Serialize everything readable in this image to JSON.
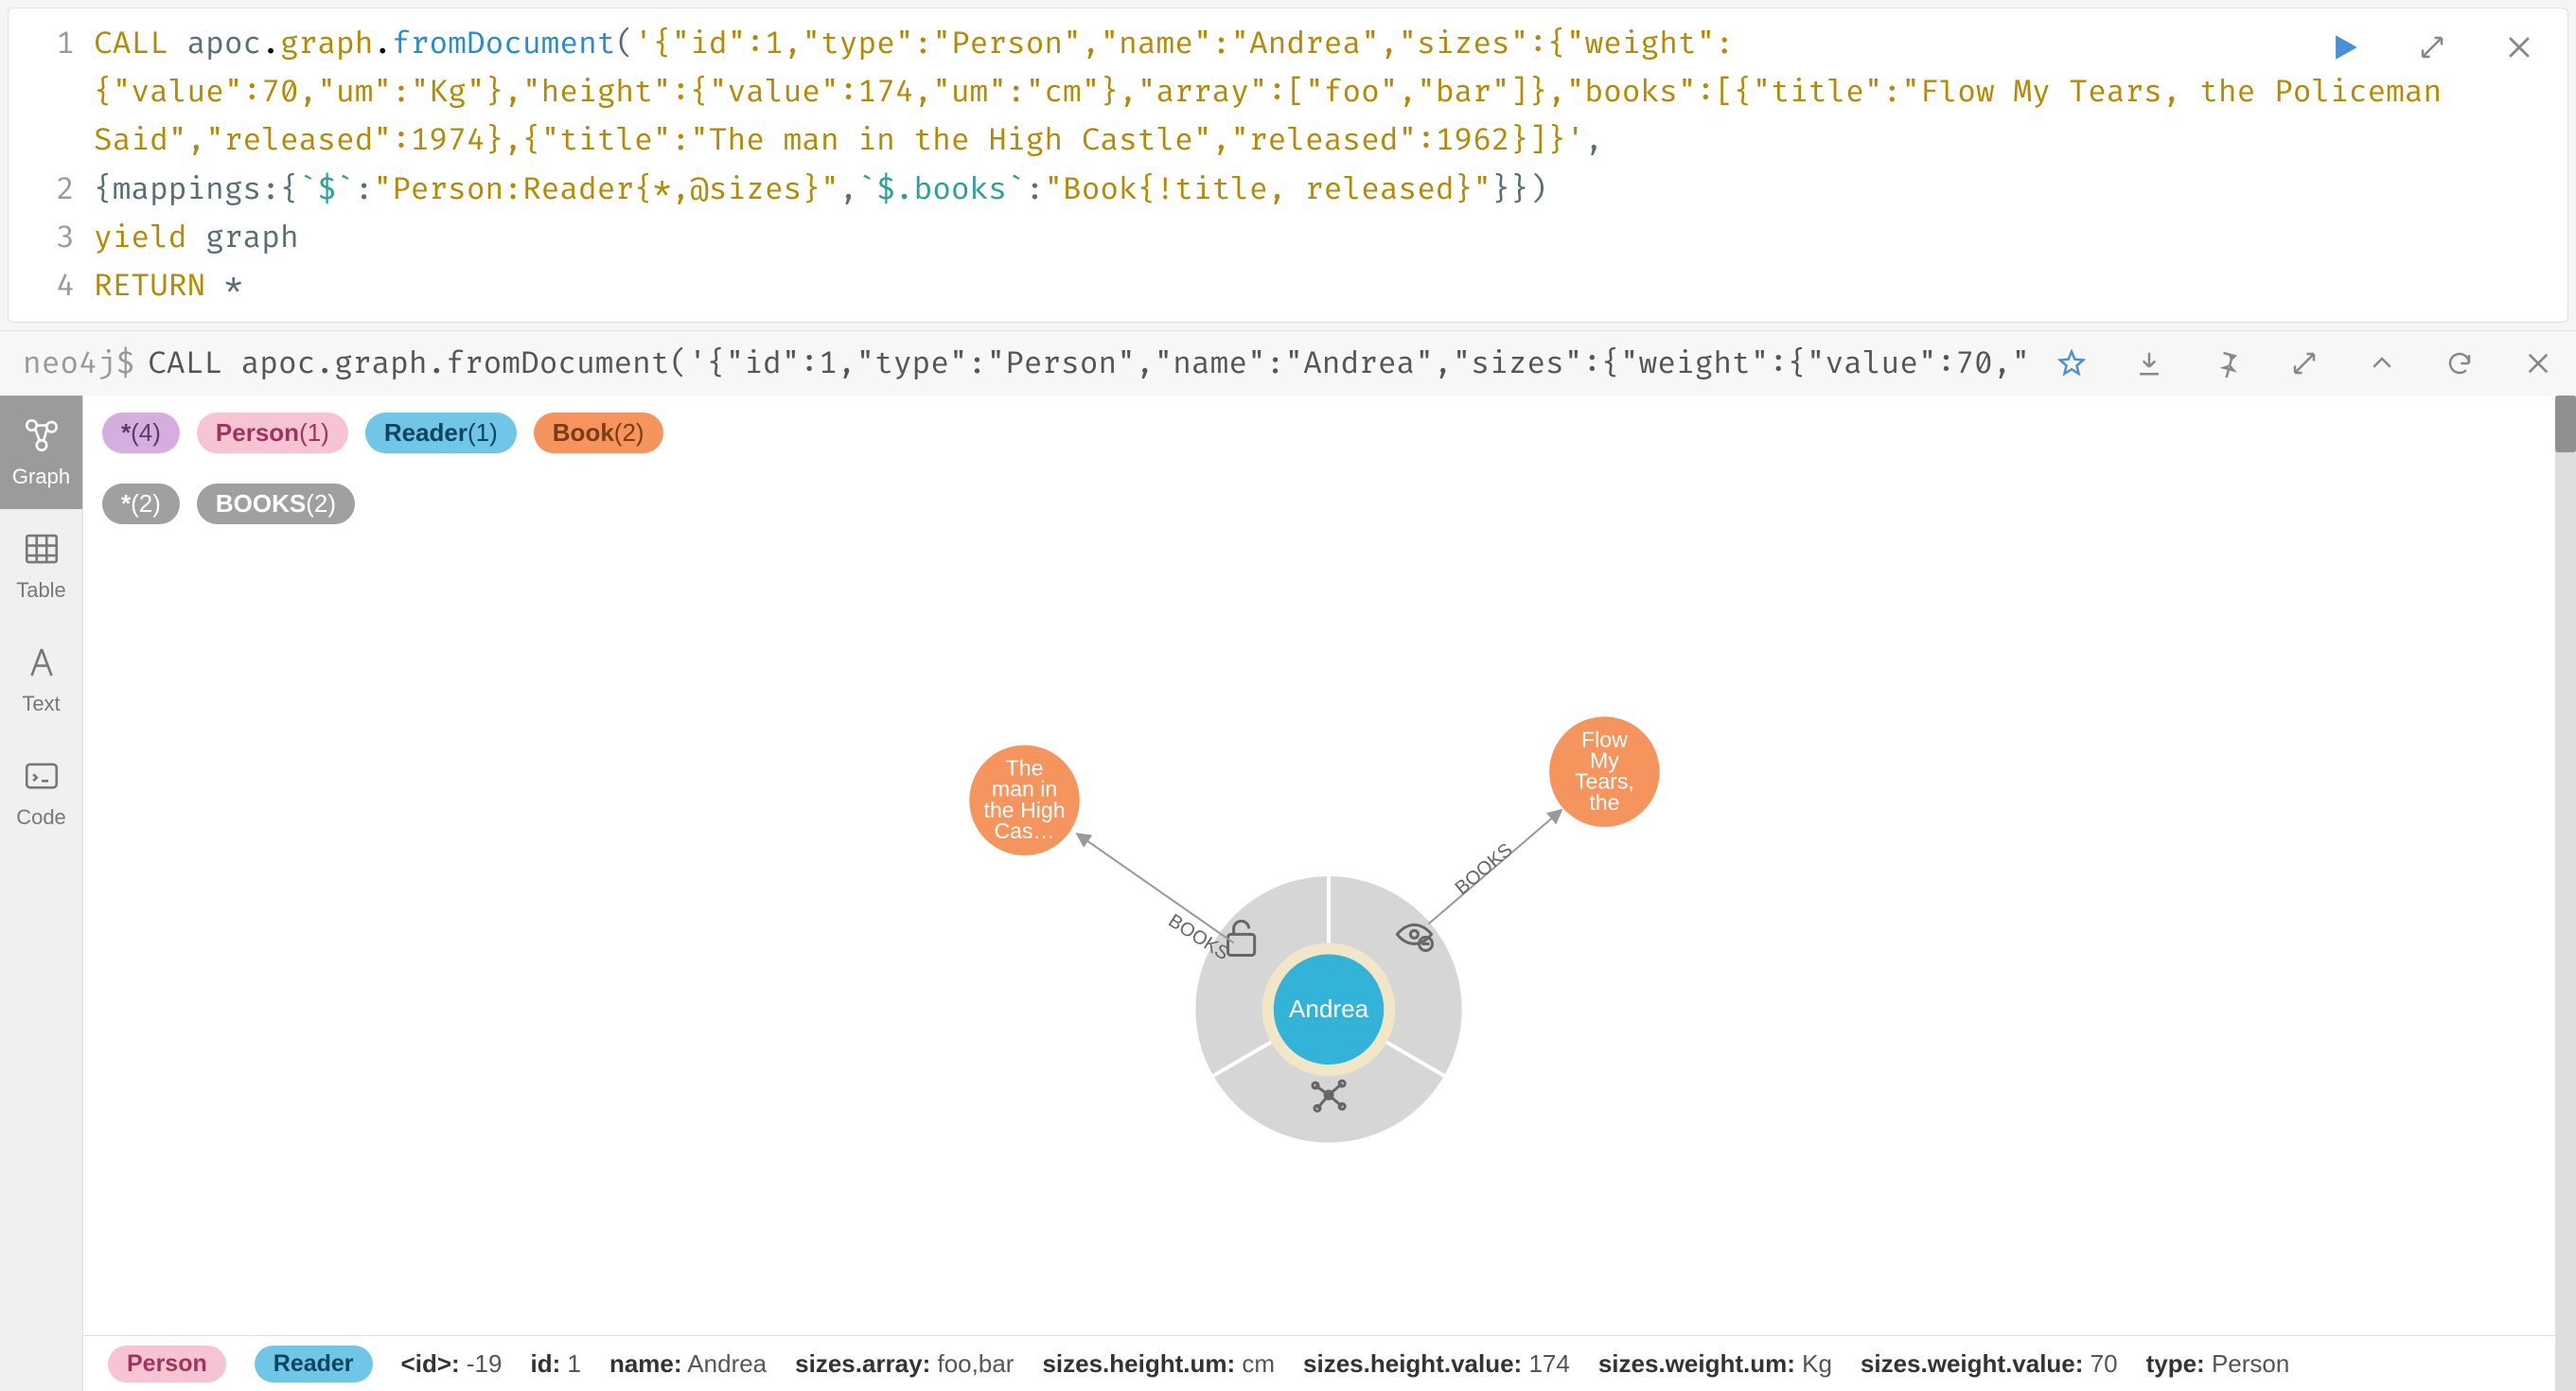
{
  "editor": {
    "lines": [
      1,
      2,
      3,
      4
    ]
  },
  "query": {
    "call": "CALL",
    "ns1": "apoc",
    "ns2": "graph",
    "fn": "fromDocument",
    "yield": "yield",
    "graph_var": "graph",
    "return_kw": "RETURN",
    "star": "*",
    "json_line1": "'{\"id\":1,\"type\":\"Person\",\"name\":\"Andrea\",\"sizes\":{\"weight\":",
    "json_line1b": "{\"value\":70,\"um\":\"Kg\"},\"height\":{\"value\":174,\"um\":\"cm\"},\"array\":[\"foo\",\"bar\"]},\"books\":[{\"title\":\"Flow My Tears, the Policeman Said\",\"released\":1974},{\"title\":\"The man in the High Castle\",\"released\":1962}]}'",
    "comma_after_json": ",",
    "mappings_open": "{mappings:{",
    "tick1": "`$`",
    "colon1": ":",
    "str1": "\"Person:Reader{*,@sizes}\"",
    "comma_mid": ",",
    "tick2": "`$.books`",
    "colon2": ":",
    "str2": "\"Book{!title, released}\"",
    "mappings_close": "}})"
  },
  "cmdbar": {
    "prompt": "neo4j$",
    "text": "CALL apoc.graph.fromDocument('{\"id\":1,\"type\":\"Person\",\"name\":\"Andrea\",\"sizes\":{\"weight\":{\"value\":70,\"um\"…"
  },
  "viewtabs": {
    "graph": "Graph",
    "table": "Table",
    "text": "Text",
    "code": "Code"
  },
  "node_pills": [
    {
      "label": "*",
      "count": "(4)",
      "cls": "pill-star"
    },
    {
      "label": "Person",
      "count": "(1)",
      "cls": "pill-person"
    },
    {
      "label": "Reader",
      "count": "(1)",
      "cls": "pill-reader"
    },
    {
      "label": "Book",
      "count": "(2)",
      "cls": "pill-book"
    }
  ],
  "rel_pills": [
    {
      "label": "*",
      "count": "(2)",
      "cls": "pill-rel-star"
    },
    {
      "label": "BOOKS",
      "count": "(2)",
      "cls": "pill-rel-books"
    }
  ],
  "graph": {
    "center": {
      "label": "Andrea"
    },
    "book1": {
      "lines": [
        "The",
        "man in",
        "the High",
        "Cas…"
      ]
    },
    "book2": {
      "lines": [
        "Flow",
        "My",
        "Tears,",
        "the"
      ]
    },
    "edge_label": "BOOKS"
  },
  "status": {
    "pills": [
      {
        "label": "Person",
        "cls": "pill-person"
      },
      {
        "label": "Reader",
        "cls": "pill-reader"
      }
    ],
    "kv": [
      {
        "k": "<id>:",
        "v": " -19"
      },
      {
        "k": "id:",
        "v": " 1"
      },
      {
        "k": "name:",
        "v": " Andrea"
      },
      {
        "k": "sizes.array:",
        "v": " foo,bar"
      },
      {
        "k": "sizes.height.um:",
        "v": " cm"
      },
      {
        "k": "sizes.height.value:",
        "v": " 174"
      },
      {
        "k": "sizes.weight.um:",
        "v": " Kg"
      },
      {
        "k": "sizes.weight.value:",
        "v": " 70"
      },
      {
        "k": "type:",
        "v": " Person"
      }
    ]
  },
  "chart_data": {
    "type": "graph",
    "nodes": [
      {
        "id": "andrea",
        "labels": [
          "Person",
          "Reader"
        ],
        "display": "Andrea",
        "props": {
          "id": 1,
          "name": "Andrea",
          "sizes.array": "foo,bar",
          "sizes.height.um": "cm",
          "sizes.height.value": 174,
          "sizes.weight.um": "Kg",
          "sizes.weight.value": 70,
          "type": "Person"
        }
      },
      {
        "id": "book1",
        "labels": [
          "Book"
        ],
        "display": "The man in the High Cas…",
        "props": {
          "title": "The man in the High Castle",
          "released": 1962
        }
      },
      {
        "id": "book2",
        "labels": [
          "Book"
        ],
        "display": "Flow My Tears, the",
        "props": {
          "title": "Flow My Tears, the Policeman Said",
          "released": 1974
        }
      }
    ],
    "edges": [
      {
        "from": "andrea",
        "to": "book1",
        "type": "BOOKS"
      },
      {
        "from": "andrea",
        "to": "book2",
        "type": "BOOKS"
      }
    ],
    "label_counts": {
      "*": 4,
      "Person": 1,
      "Reader": 1,
      "Book": 2
    },
    "relationship_counts": {
      "*": 2,
      "BOOKS": 2
    }
  }
}
